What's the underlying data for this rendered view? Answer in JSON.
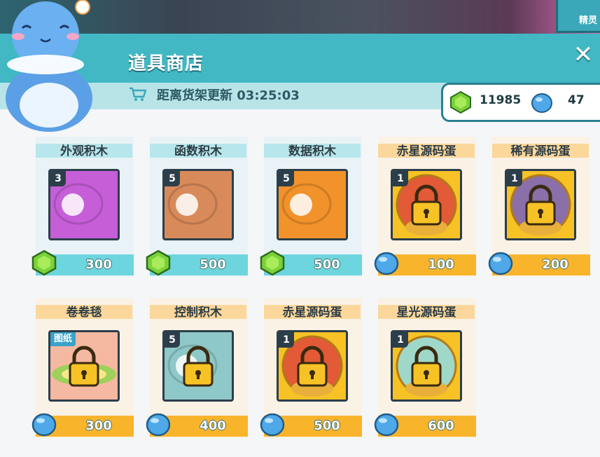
{
  "top_corner": {
    "label": "精灵"
  },
  "shop": {
    "title": "道具商店",
    "timer_label": "距离货架更新 03:25:03",
    "close_icon": "close-icon"
  },
  "currency": {
    "gem_count": "11985",
    "orb_count": "47"
  },
  "items": [
    {
      "label": "外观积木",
      "count": "3",
      "price": "300",
      "currency": "gem",
      "theme": "blue",
      "art": "looks",
      "color": "#c65ed8"
    },
    {
      "label": "函数积木",
      "count": "5",
      "price": "500",
      "currency": "gem",
      "theme": "blue",
      "art": "procedure",
      "color": "#d98a5a"
    },
    {
      "label": "数据积木",
      "count": "5",
      "price": "500",
      "currency": "gem",
      "theme": "blue",
      "art": "data",
      "color": "#f1922a"
    },
    {
      "label": "赤星源码蛋",
      "count": "1",
      "price": "100",
      "currency": "orb",
      "theme": "orange",
      "art": "egg-red",
      "color": "#e25a36"
    },
    {
      "label": "稀有源码蛋",
      "count": "1",
      "price": "200",
      "currency": "orb",
      "theme": "orange",
      "art": "egg-purple",
      "color": "#8a6fa8"
    },
    {
      "label": "卷卷毯",
      "tag": "图纸",
      "price": "300",
      "currency": "orb",
      "theme": "orange",
      "art": "carpet",
      "color": "#f5b8a0"
    },
    {
      "label": "控制积木",
      "count": "5",
      "price": "400",
      "currency": "orb",
      "theme": "orange",
      "art": "control",
      "color": "#8fc8c8"
    },
    {
      "label": "赤星源码蛋",
      "count": "1",
      "price": "500",
      "currency": "orb",
      "theme": "orange",
      "art": "egg-red",
      "color": "#e25a36"
    },
    {
      "label": "星光源码蛋",
      "count": "1",
      "price": "600",
      "currency": "orb",
      "theme": "orange",
      "art": "egg-star",
      "color": "#9fd8c8"
    }
  ]
}
